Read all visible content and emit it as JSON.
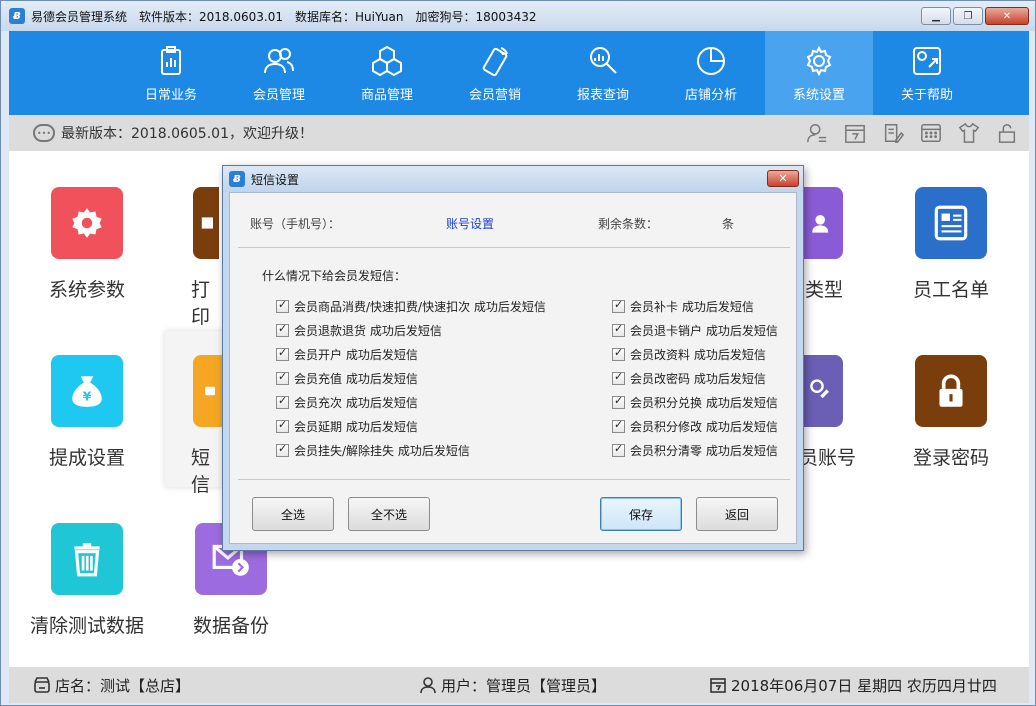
{
  "window": {
    "app_name": "易德会员管理系统",
    "version_text": "软件版本：2018.0603.01",
    "db_text": "数据库名：HuiYuan",
    "dongle_text": "加密狗号：18003432",
    "controls": {
      "minimize": "▁",
      "restore": "❐",
      "close": "✕"
    }
  },
  "nav": {
    "items": [
      {
        "label": "日常业务",
        "icon": "clipboard-icon"
      },
      {
        "label": "会员管理",
        "icon": "users-icon"
      },
      {
        "label": "商品管理",
        "icon": "cubes-icon"
      },
      {
        "label": "会员营销",
        "icon": "phone-icon"
      },
      {
        "label": "报表查询",
        "icon": "search-icon"
      },
      {
        "label": "店铺分析",
        "icon": "pie-icon"
      },
      {
        "label": "系统设置",
        "icon": "gear-icon",
        "active": true
      },
      {
        "label": "关于帮助",
        "icon": "help-icon"
      }
    ]
  },
  "infobar": {
    "message": "最新版本：2018.0605.01，欢迎升级！"
  },
  "tiles": {
    "system_params": "系统参数",
    "print": "打印",
    "member_type": "类型",
    "staff_list": "员工名单",
    "commission": "提成设置",
    "sms": "短信",
    "member_account": "员账号",
    "login_password": "登录密码",
    "clear_test": "清除测试数据",
    "backup": "数据备份"
  },
  "statusbar": {
    "store": "店名：测试【总店】",
    "user": "用户：管理员【管理员】",
    "date": "2018年06月07日 星期四 农历四月廿四"
  },
  "dialog": {
    "title": "短信设置",
    "account_label": "账号（手机号）：",
    "account_link": "账号设置",
    "remaining_label": "剩余条数：",
    "remaining_unit": "条",
    "question": "什么情况下给会员发短信：",
    "left_options": [
      "会员商品消费/快速扣费/快速扣次  成功后发短信",
      "会员退款退货  成功后发短信",
      "会员开户  成功后发短信",
      "会员充值  成功后发短信",
      "会员充次  成功后发短信",
      "会员延期  成功后发短信",
      "会员挂失/解除挂失  成功后发短信"
    ],
    "right_options": [
      "会员补卡  成功后发短信",
      "会员退卡销户  成功后发短信",
      "会员改资料  成功后发短信",
      "会员改密码  成功后发短信",
      "会员积分兑换  成功后发短信",
      "会员积分修改  成功后发短信",
      "会员积分清零  成功后发短信"
    ],
    "buttons": {
      "select_all": "全选",
      "select_none": "全不选",
      "save": "保存",
      "back": "返回"
    }
  },
  "colors": {
    "nav_bg": "#1e88e5",
    "nav_active": "#4aa3ef",
    "tile_red": "#f0515a",
    "tile_brown": "#7a3d0c",
    "tile_purple": "#8a5bd6",
    "tile_blue": "#2a6fc9",
    "tile_cyan": "#1ec8f0",
    "tile_orange": "#f5a623",
    "tile_violet": "#6b5fb5",
    "tile_teal": "#1fc6d6",
    "tile_lilac": "#9d6be0",
    "link_blue": "#1f3fd1"
  }
}
